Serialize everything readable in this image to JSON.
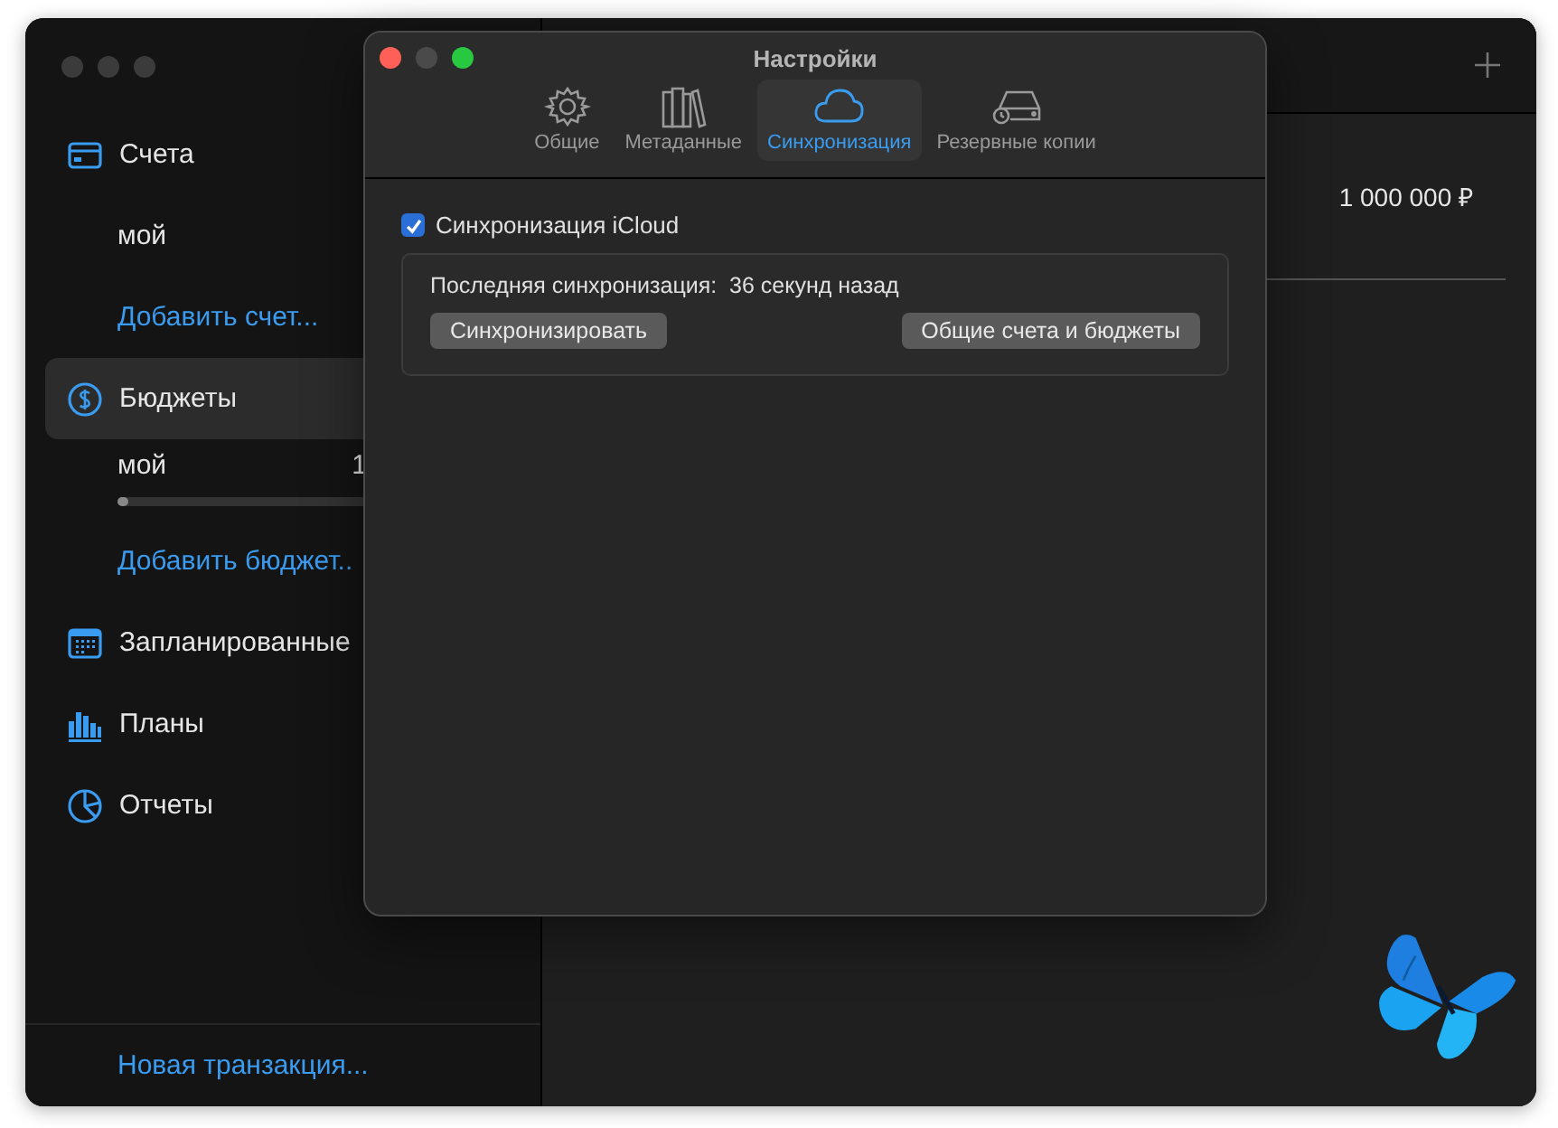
{
  "sidebar": {
    "items": [
      {
        "kind": "section",
        "label": "Счета",
        "selected": false
      },
      {
        "kind": "entry",
        "label": "мой"
      },
      {
        "kind": "add",
        "label": "Добавить счет..."
      },
      {
        "kind": "section",
        "label": "Бюджеты",
        "selected": true
      },
      {
        "kind": "budget",
        "label": "мой",
        "amount": "1",
        "level": 0
      },
      {
        "kind": "add",
        "label": "Добавить бюджет.."
      },
      {
        "kind": "section",
        "label": "Запланированные",
        "selected": false
      },
      {
        "kind": "section",
        "label": "Планы",
        "selected": false
      },
      {
        "kind": "section",
        "label": "Отчеты",
        "selected": false
      }
    ],
    "footer_link": "Новая транзакция..."
  },
  "main": {
    "amount": "1 000 000 ₽"
  },
  "settings": {
    "title": "Настройки",
    "tabs": [
      {
        "label": "Общие",
        "selected": false
      },
      {
        "label": "Метаданные",
        "selected": false
      },
      {
        "label": "Синхронизация",
        "selected": true
      },
      {
        "label": "Резервные копии",
        "selected": false
      }
    ],
    "icloud": {
      "label": "Синхронизация iCloud",
      "checked": true
    },
    "last_sync": "Последняя синхронизация:  36 секунд назад",
    "buttons": [
      "Синхронизировать",
      "Общие счета и бюджеты"
    ]
  }
}
